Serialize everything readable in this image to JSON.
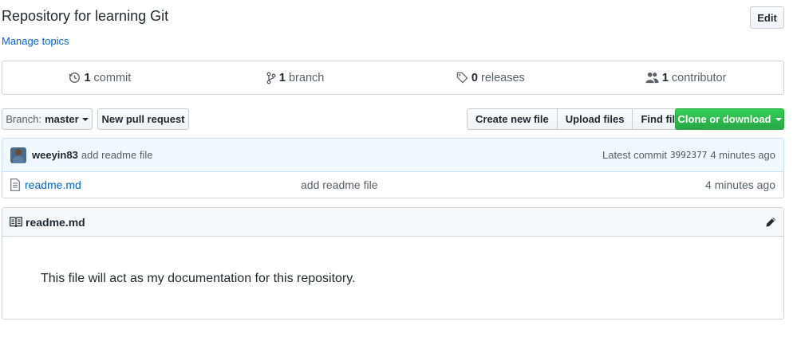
{
  "repo": {
    "description": "Repository for learning Git",
    "manage_topics": "Manage topics",
    "edit_label": "Edit"
  },
  "numbers": {
    "commits": {
      "count": "1",
      "label": "commit"
    },
    "branches": {
      "count": "1",
      "label": "branch"
    },
    "releases": {
      "count": "0",
      "label": "releases"
    },
    "contributors": {
      "count": "1",
      "label": "contributor"
    }
  },
  "file_nav": {
    "branch_prefix": "Branch:",
    "branch_name": "master",
    "new_pull_request": "New pull request",
    "create_new_file": "Create new file",
    "upload_files": "Upload files",
    "find_file": "Find file",
    "clone_or_download": "Clone or download"
  },
  "latest_commit": {
    "author": "weeyin83",
    "message": "add readme file",
    "prefix": "Latest commit",
    "sha": "3992377",
    "age": "4 minutes ago"
  },
  "files": [
    {
      "name": "readme.md",
      "commit_message": "add readme file",
      "age": "4 minutes ago"
    }
  ],
  "readme": {
    "title": "readme.md",
    "body": "This file will act as my documentation for this repository."
  },
  "colors": {
    "link": "#0366d6",
    "clone_green": "#28a745",
    "commit_bg": "#f1f8ff"
  },
  "icons": {
    "commits": "history-icon",
    "branches": "git-branch-icon",
    "releases": "tag-icon",
    "contributors": "people-icon",
    "file": "file-text-icon",
    "readme": "book-icon",
    "edit": "pencil-icon"
  }
}
